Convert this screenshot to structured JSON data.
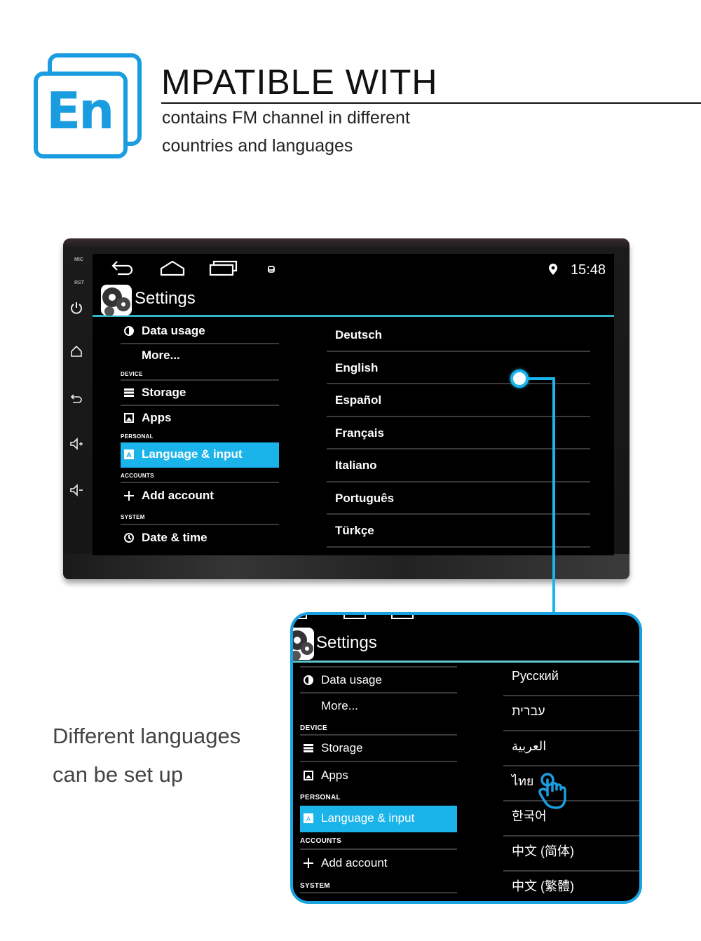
{
  "header": {
    "logo_text": "En",
    "headline": "MPATIBLE WITH",
    "sub_line_1": "contains FM channel in different",
    "sub_line_2": "countries and languages",
    "accent_color": "#1a9de0"
  },
  "head_unit": {
    "bezel": {
      "labels": [
        "MIC",
        "RST"
      ],
      "buttons": [
        "power-icon",
        "home-icon",
        "back-icon",
        "volume-up-icon",
        "volume-down-icon"
      ]
    },
    "status_bar": {
      "nav_icons": [
        "back-icon",
        "home-icon",
        "recent-apps-icon",
        "notification-icon"
      ],
      "location_icon": "location-icon",
      "time": "15:48"
    },
    "app_title": "Settings",
    "left_menu": [
      {
        "type": "item",
        "icon": "data-usage-icon",
        "label": "Data usage"
      },
      {
        "type": "item",
        "icon": "",
        "label": "More..."
      },
      {
        "type": "header",
        "label": "DEVICE"
      },
      {
        "type": "item",
        "icon": "storage-icon",
        "label": "Storage"
      },
      {
        "type": "item",
        "icon": "apps-icon",
        "label": "Apps"
      },
      {
        "type": "header",
        "label": "PERSONAL"
      },
      {
        "type": "item",
        "icon": "language-icon",
        "label": "Language & input",
        "selected": true
      },
      {
        "type": "header",
        "label": "ACCOUNTS"
      },
      {
        "type": "item",
        "icon": "add-icon",
        "label": "Add account"
      },
      {
        "type": "header",
        "label": "SYSTEM"
      },
      {
        "type": "item",
        "icon": "clock-icon",
        "label": "Date & time"
      }
    ],
    "languages": [
      "Deutsch",
      "English",
      "Español",
      "Français",
      "Italiano",
      "Português",
      "Türkçe"
    ],
    "highlight_color": "#1ab3ea",
    "divider_color": "#33b5c5"
  },
  "inset": {
    "app_title": "Settings",
    "left_menu": [
      {
        "type": "item",
        "icon": "data-usage-icon",
        "label": "Data usage"
      },
      {
        "type": "item",
        "icon": "",
        "label": "More..."
      },
      {
        "type": "header",
        "label": "DEVICE"
      },
      {
        "type": "item",
        "icon": "storage-icon",
        "label": "Storage"
      },
      {
        "type": "item",
        "icon": "apps-icon",
        "label": "Apps"
      },
      {
        "type": "header",
        "label": "PERSONAL"
      },
      {
        "type": "item",
        "icon": "language-icon",
        "label": "Language & input",
        "selected": true
      },
      {
        "type": "header",
        "label": "ACCOUNTS"
      },
      {
        "type": "item",
        "icon": "add-icon",
        "label": "Add account"
      },
      {
        "type": "header",
        "label": "SYSTEM"
      }
    ],
    "languages": [
      "Русский",
      "עברית",
      "العربية",
      "ไทย",
      "한국어",
      "中文 (简体)",
      "中文 (繁體)"
    ],
    "pointer_icon": "hand-pointer-icon",
    "border_color": "#19a2e0"
  },
  "caption": {
    "line_1": "Different languages",
    "line_2": "can be set up"
  }
}
